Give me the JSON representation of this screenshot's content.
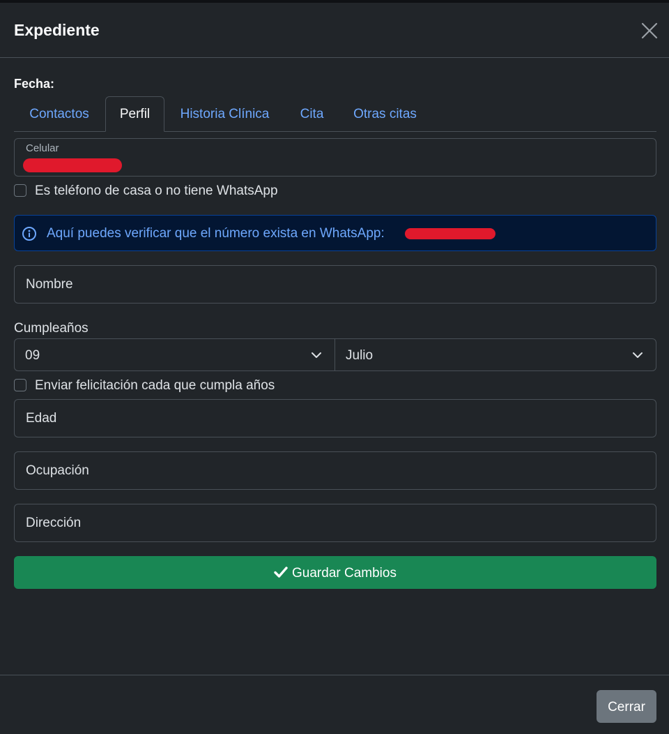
{
  "header": {
    "title": "Expediente"
  },
  "fecha_label": "Fecha:",
  "tabs": [
    {
      "label": "Contactos",
      "active": false
    },
    {
      "label": "Perfil",
      "active": true
    },
    {
      "label": "Historia Clínica",
      "active": false
    },
    {
      "label": "Cita",
      "active": false
    },
    {
      "label": "Otras citas",
      "active": false
    }
  ],
  "form": {
    "celular": {
      "label": "Celular",
      "value": "[redacted]"
    },
    "home_phone_checkbox": {
      "label": "Es teléfono de casa o no tiene WhatsApp",
      "checked": false
    },
    "whatsapp_alert": {
      "text": "Aquí puedes verificar que el número exista en WhatsApp:",
      "link_text": "[redacted]"
    },
    "nombre": {
      "placeholder": "Nombre"
    },
    "cumpleanos": {
      "label": "Cumpleaños",
      "day": "09",
      "month": "Julio"
    },
    "felicitacion_checkbox": {
      "label": "Enviar felicitación cada que cumpla años",
      "checked": false
    },
    "edad": {
      "placeholder": "Edad"
    },
    "ocupacion": {
      "placeholder": "Ocupación"
    },
    "direccion": {
      "placeholder": "Dirección"
    },
    "save_button": "Guardar Cambios"
  },
  "footer": {
    "close_button": "Cerrar"
  },
  "colors": {
    "background": "#212529",
    "link": "#6ea8fe",
    "success": "#198754",
    "secondary": "#6c757d",
    "redaction": "#e0192c"
  },
  "icons": {
    "close": "close-icon",
    "info": "info-circle-icon",
    "chevron": "chevron-down-icon",
    "check": "check-icon"
  }
}
